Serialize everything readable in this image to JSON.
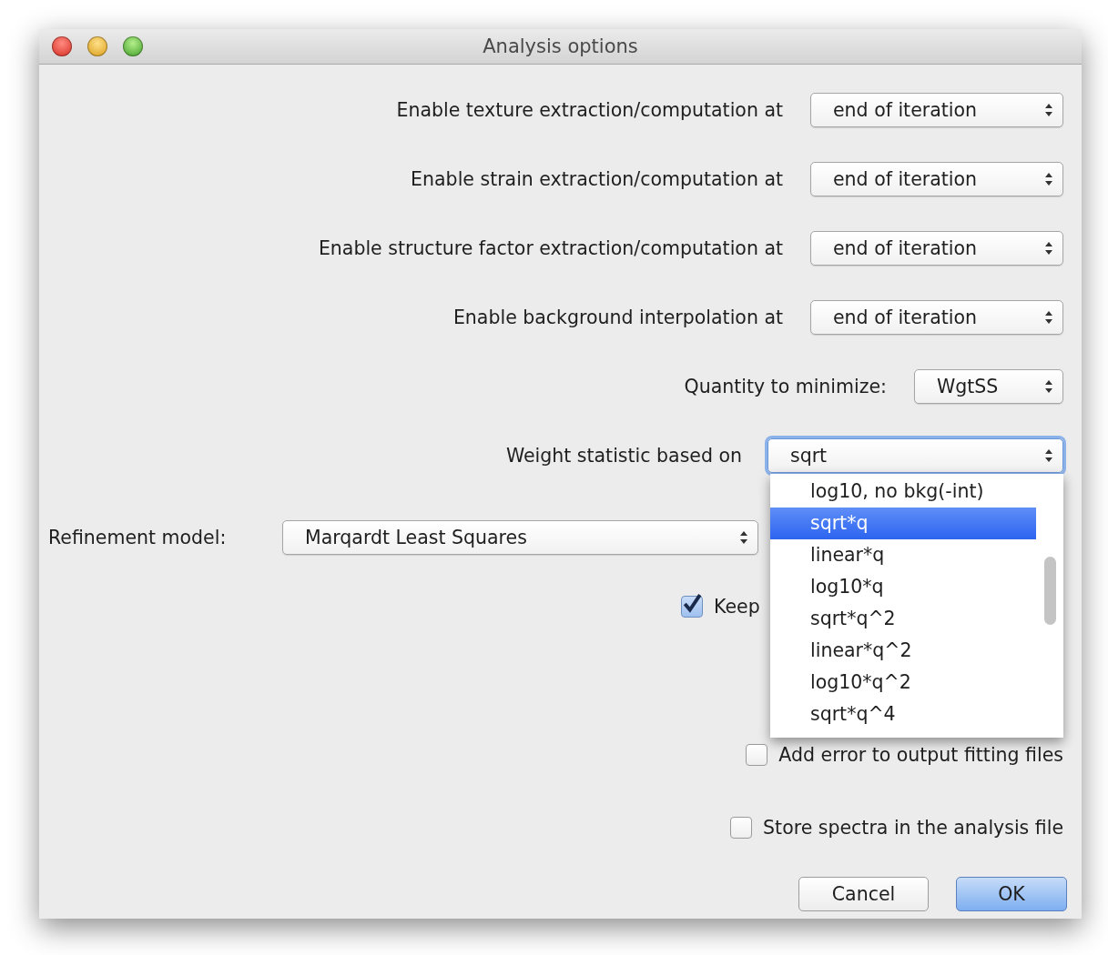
{
  "window": {
    "title": "Analysis options"
  },
  "rows": [
    {
      "kind": "popup",
      "label": "Enable texture extraction/computation at",
      "value": "end of iteration",
      "open": false
    },
    {
      "kind": "popup",
      "label": "Enable strain extraction/computation at",
      "value": "end of iteration",
      "open": false
    },
    {
      "kind": "popup",
      "label": "Enable structure factor extraction/computation at",
      "value": "end of iteration",
      "open": false
    },
    {
      "kind": "popup",
      "label": "Enable background interpolation at",
      "value": "end of iteration",
      "open": false
    },
    {
      "kind": "popup",
      "label": "Quantity to minimize:",
      "value": "WgtSS",
      "open": false
    },
    {
      "kind": "popup",
      "label": "Weight statistic based on",
      "value": "sqrt",
      "open": true,
      "menu": [
        {
          "label": "log10, no bkg(-int)",
          "selected": false
        },
        {
          "label": "sqrt*q",
          "selected": true
        },
        {
          "label": "linear*q",
          "selected": false
        },
        {
          "label": "log10*q",
          "selected": false
        },
        {
          "label": "sqrt*q^2",
          "selected": false
        },
        {
          "label": "linear*q^2",
          "selected": false
        },
        {
          "label": "log10*q^2",
          "selected": false
        },
        {
          "label": "sqrt*q^4",
          "selected": false
        }
      ]
    },
    {
      "kind": "model",
      "label": "Refinement model:",
      "value": "Marqardt Least Squares",
      "open": false
    },
    {
      "kind": "checkbox",
      "label": "Keep",
      "checked": true
    },
    {
      "kind": "checkbox",
      "label": "Add error to output fitting files",
      "checked": false
    },
    {
      "kind": "checkbox",
      "label": "Store spectra in the analysis file",
      "checked": false
    }
  ],
  "buttons": [
    {
      "label": "Cancel",
      "default": false
    },
    {
      "label": "OK",
      "default": true
    }
  ]
}
